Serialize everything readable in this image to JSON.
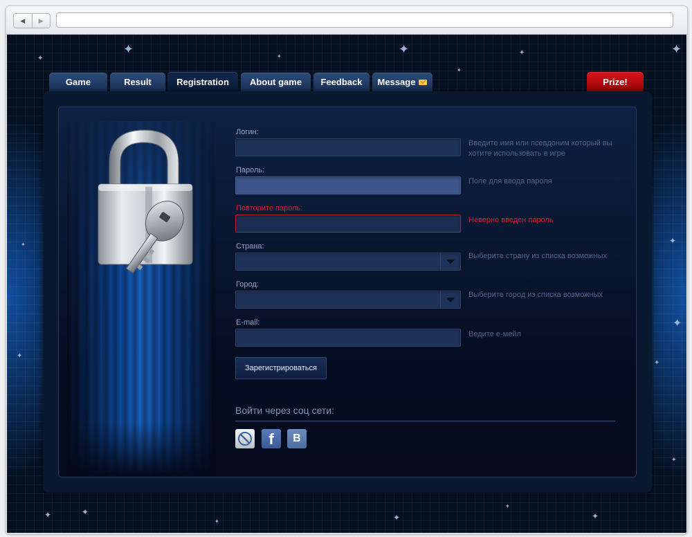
{
  "browser": {
    "back_icon": "back-arrow-icon",
    "forward_icon": "forward-arrow-icon",
    "url": ""
  },
  "tabs": [
    {
      "label": "Game"
    },
    {
      "label": "Result"
    },
    {
      "label": "Registration",
      "active": true
    },
    {
      "label": "About game"
    },
    {
      "label": "Feedback"
    },
    {
      "label": "Message",
      "icon": "mail-icon"
    },
    {
      "label": "Prize!",
      "accent": "#c20a10"
    }
  ],
  "form": {
    "login": {
      "label": "Логин:",
      "value": "",
      "hint": "Введите имя или псевдоним который вы хотите использовать в игре"
    },
    "password": {
      "label": "Пароль:",
      "value": "",
      "hint": "Поле для ввода пароля"
    },
    "password_repeat": {
      "label": "Повторите пароль:",
      "value": "",
      "hint": "Неверно введен пароль"
    },
    "country": {
      "label": "Страна:",
      "value": "",
      "hint": "Выберите страну из списка возможных"
    },
    "city": {
      "label": "Город:",
      "value": "",
      "hint": "Выберите город из списка возможных"
    },
    "email": {
      "label": "E-mail:",
      "value": "",
      "hint": "Ведите е-мейл"
    },
    "submit_label": "Зарегистрироваться"
  },
  "social": {
    "title": "Войти через соц сети:",
    "networks": [
      {
        "icon": "livejournal-icon"
      },
      {
        "icon": "facebook-icon",
        "glyph": "f"
      },
      {
        "icon": "vkontakte-icon",
        "glyph": "B"
      }
    ]
  },
  "colors": {
    "background": "#071428",
    "tab": "#1a3259",
    "prize_tab": "#c20a10",
    "error": "#d9222b"
  }
}
